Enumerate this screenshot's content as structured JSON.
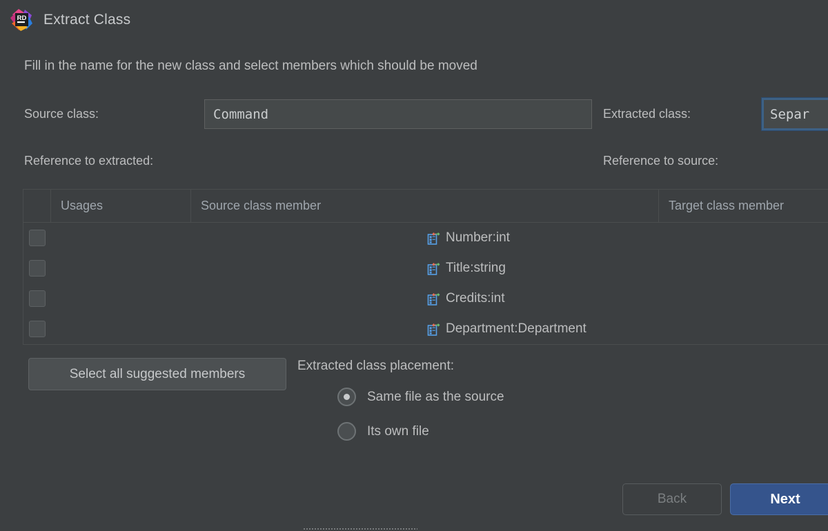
{
  "window": {
    "title": "Extract Class",
    "logo_icon": "rider-logo-icon",
    "background_color": "#3c3f41"
  },
  "instruction": "Fill in the name for the new class and select members which should be moved",
  "form": {
    "source_class_label": "Source class:",
    "source_class_value": "Command",
    "extracted_class_label": "Extracted class:",
    "extracted_class_value": "Separ",
    "extracted_class_focused": true,
    "reference_to_extracted_label": "Reference to extracted:",
    "reference_to_source_label": "Reference to source:"
  },
  "members_table": {
    "columns": [
      "",
      "Usages",
      "Source class member",
      "Target class member"
    ],
    "rows": [
      {
        "checked": false,
        "usages": "",
        "source_member": "Number:int",
        "target_member": "",
        "icon": "property-icon"
      },
      {
        "checked": false,
        "usages": "",
        "source_member": "Title:string",
        "target_member": "",
        "icon": "property-icon"
      },
      {
        "checked": false,
        "usages": "",
        "source_member": "Credits:int",
        "target_member": "",
        "icon": "property-icon"
      },
      {
        "checked": false,
        "usages": "",
        "source_member": "Department:Department",
        "target_member": "",
        "icon": "property-icon"
      }
    ]
  },
  "actions": {
    "select_all_label": "Select all suggested members"
  },
  "placement": {
    "label": "Extracted class placement:",
    "options": [
      {
        "label": "Same file as the source",
        "selected": true
      },
      {
        "label": "Its own file",
        "selected": false
      }
    ]
  },
  "footer": {
    "back_label": "Back",
    "back_enabled": false,
    "next_label": "Next",
    "next_enabled": true,
    "next_accent_color": "#35548c"
  }
}
